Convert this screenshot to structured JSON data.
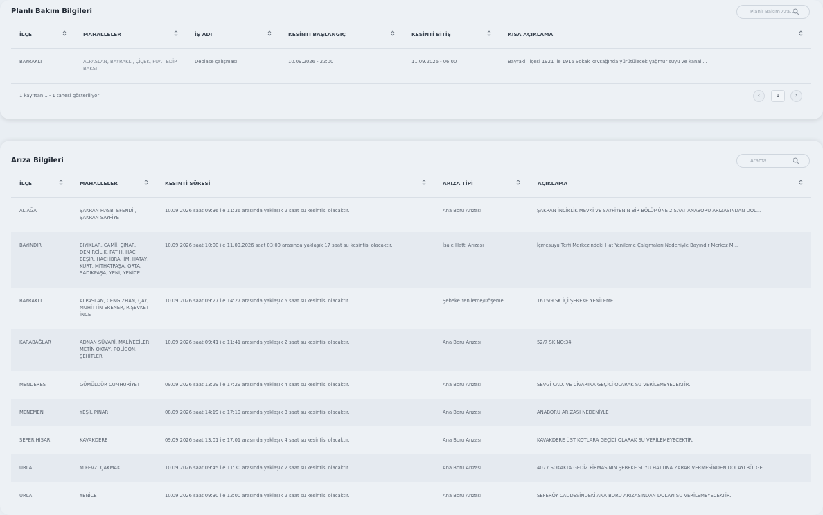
{
  "planned": {
    "title": "Planlı Bakım Bilgileri",
    "search_placeholder": "Planlı Bakım Ara...",
    "columns": [
      "İLÇE",
      "MAHALLELER",
      "İŞ ADI",
      "KESİNTİ BAŞLANGIÇ",
      "KESİNTİ BİTİŞ",
      "KISA AÇIKLAMA"
    ],
    "rows": [
      {
        "ilce": "BAYRAKLI",
        "mahalleler": "ALPASLAN, BAYRAKLI, ÇİÇEK, FUAT EDİP BAKSI",
        "is_adi": "Deplase çalışması",
        "baslangic": "10.09.2026 - 22:00",
        "bitis": "11.09.2026 - 06:00",
        "aciklama": "Bayraklı ilçesi 1921 ile 1916 Sokak kavşağında yürütülecek yağmur suyu ve kanali..."
      }
    ],
    "footer": "1 kayıttan 1 - 1 tanesi gösteriliyor",
    "pagination": {
      "prev": "‹",
      "page": "1",
      "next": "›"
    }
  },
  "faults": {
    "title": "Arıza Bilgileri",
    "search_placeholder": "Arama",
    "columns": [
      "İLÇE",
      "MAHALLELER",
      "KESİNTİ SÜRESİ",
      "ARIZA TİPİ",
      "AÇIKLAMA"
    ],
    "rows": [
      {
        "ilce": "ALİAĞA",
        "mahalleler": "ŞAKRAN HASBİ EFENDİ , ŞAKRAN SAYFİYE",
        "sure": "10.09.2026 saat 09:36 ile 11:36 arasında yaklaşık 2 saat su kesintisi olacaktır.",
        "tip": "Ana Boru Arızası",
        "aciklama": "ŞAKRAN İNCİRLİK MEVKİ VE SAYFİYENİN BİR BÖLÜMÜNE 2 SAAT ANABORU ARIZASINDAN DOL..."
      },
      {
        "ilce": "BAYINDIR",
        "mahalleler": "BIYIKLAR, CAMİİ, ÇINAR, DEMİRCİLİK, FATİH, HACI BEŞİR, HACI İBRAHİM, HATAY, KURT, MİTHATPAŞA, ORTA, SADIKPAŞA, YENİ, YENİCE",
        "sure": "10.09.2026 saat 10:00 ile 11.09.2026 saat 03:00 arasında yaklaşık 17 saat su kesintisi olacaktır.",
        "tip": "İsale Hattı Arızası",
        "aciklama": "İçmesuyu Terfi Merkezindeki Hat Yenileme Çalışmaları Nedeniyle Bayındır Merkez M..."
      },
      {
        "ilce": "BAYRAKLI",
        "mahalleler": "ALPASLAN, CENGİZHAN, ÇAY, MUHİTTİN ERENER, R.ŞEVKET İNCE",
        "sure": "10.09.2026 saat 09:27 ile 14:27 arasında yaklaşık 5 saat su kesintisi olacaktır.",
        "tip": "Şebeke Yenileme/Döşeme",
        "aciklama": "1615/9 SK İÇİ ŞEBEKE YENİLEME"
      },
      {
        "ilce": "KARABAĞLAR",
        "mahalleler": "ADNAN SÜVARİ, MALİYECİLER, METİN OKTAY, POLİGON, ŞEHİTLER",
        "sure": "10.09.2026 saat 09:41 ile 11:41 arasında yaklaşık 2 saat su kesintisi olacaktır.",
        "tip": "Ana Boru Arızası",
        "aciklama": "52/7 SK NO:34"
      },
      {
        "ilce": "MENDERES",
        "mahalleler": "GÜMÜLDÜR CUMHURİYET",
        "sure": "09.09.2026 saat 13:29 ile 17:29 arasında yaklaşık 4 saat su kesintisi olacaktır.",
        "tip": "Ana Boru Arızası",
        "aciklama": "SEVGİ CAD. VE CİVARINA GEÇİCİ OLARAK SU VERİLEMEYECEKTİR."
      },
      {
        "ilce": "MENEMEN",
        "mahalleler": "YEŞİL PINAR",
        "sure": "08.09.2026 saat 14:19 ile 17:19 arasında yaklaşık 3 saat su kesintisi olacaktır.",
        "tip": "Ana Boru Arızası",
        "aciklama": "ANABORU ARIZASI NEDENİYLE"
      },
      {
        "ilce": "SEFERİHİSAR",
        "mahalleler": "KAVAKDERE",
        "sure": "09.09.2026 saat 13:01 ile 17:01 arasında yaklaşık 4 saat su kesintisi olacaktır.",
        "tip": "Ana Boru Arızası",
        "aciklama": "KAVAKDERE ÜST KOTLARA GEÇİCİ OLARAK SU VERİLEMEYECEKTİR."
      },
      {
        "ilce": "URLA",
        "mahalleler": "M.FEVZİ ÇAKMAK",
        "sure": "10.09.2026 saat 09:45 ile 11:30 arasında yaklaşık 2 saat su kesintisi olacaktır.",
        "tip": "Ana Boru Arızası",
        "aciklama": "4077 SOKAKTA GEDİZ FİRMASININ ŞEBEKE SUYU HATTINA ZARAR VERMESİNDEN DOLAYI BÖLGE..."
      },
      {
        "ilce": "URLA",
        "mahalleler": "YENİCE",
        "sure": "10.09.2026 saat 09:30 ile 12:00 arasında yaklaşık 2 saat su kesintisi olacaktır.",
        "tip": "Ana Boru Arızası",
        "aciklama": "SEFERÖY CADDESİNDEKİ ANA BORU ARIZASINDAN DOLAYI SU VERİLEMEYECEKTİR."
      }
    ]
  }
}
